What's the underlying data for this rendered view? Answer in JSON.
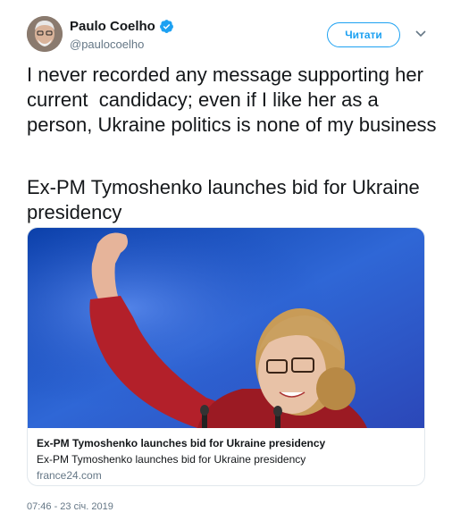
{
  "author": {
    "name": "Paulo Coelho",
    "handle": "@paulocoelho",
    "verified": true,
    "follow_label": "Читати"
  },
  "tweet": {
    "text": "I never recorded any message supporting her current  candidacy; even if I like her as a person, Ukraine politics is none of my business",
    "link_text": "Ex-PM Tymoshenko launches bid for Ukraine presidency"
  },
  "card": {
    "title": "Ex-PM Tymoshenko launches bid for Ukraine presidency",
    "description": "Ex-PM Tymoshenko launches bid for Ukraine presidency",
    "domain": "france24.com"
  },
  "timestamp": "07:46 - 23 січ. 2019",
  "colors": {
    "accent": "#1da1f2",
    "text": "#14171a",
    "muted": "#657786",
    "border": "#e1e8ed"
  },
  "icons": [
    "verified-badge-icon",
    "chevron-down-icon"
  ]
}
